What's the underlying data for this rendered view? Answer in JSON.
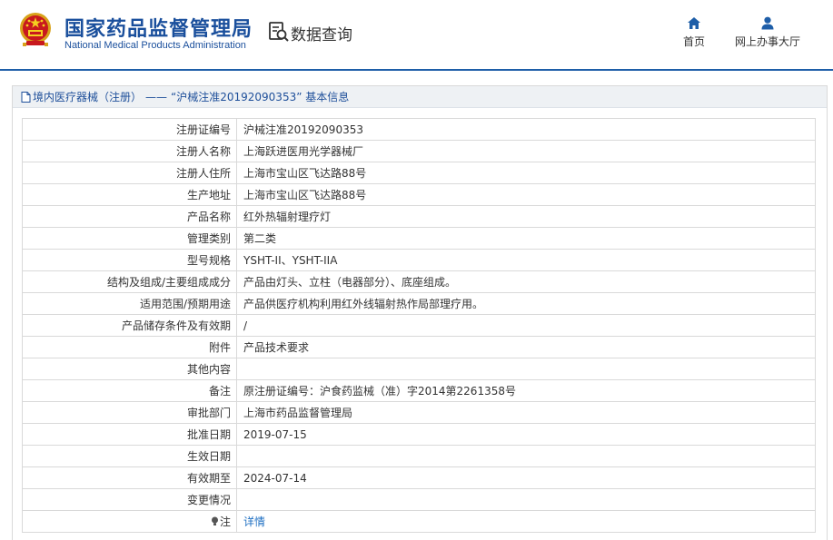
{
  "header": {
    "brand_cn": "国家药品监督管理局",
    "brand_en": "National Medical Products Administration",
    "query_label": "数据查询",
    "nav": [
      {
        "label": "首页",
        "icon": "home-icon"
      },
      {
        "label": "网上办事大厅",
        "icon": "user-icon"
      }
    ],
    "accent": "#1e5ea8"
  },
  "breadcrumb": {
    "root": "境内医疗器械（注册）",
    "separator": "——",
    "current": "“沪械注准20192090353” 基本信息"
  },
  "rows": [
    {
      "label": "注册证编号",
      "value": "沪械注准20192090353"
    },
    {
      "label": "注册人名称",
      "value": "上海跃进医用光学器械厂"
    },
    {
      "label": "注册人住所",
      "value": "上海市宝山区飞达路88号"
    },
    {
      "label": "生产地址",
      "value": "上海市宝山区飞达路88号"
    },
    {
      "label": "产品名称",
      "value": "红外热辐射理疗灯"
    },
    {
      "label": "管理类别",
      "value": "第二类"
    },
    {
      "label": "型号规格",
      "value": "YSHT-II、YSHT-IIA"
    },
    {
      "label": "结构及组成/主要组成成分",
      "value": "产品由灯头、立柱（电器部分）、底座组成。"
    },
    {
      "label": "适用范围/预期用途",
      "value": "产品供医疗机构利用红外线辐射热作局部理疗用。"
    },
    {
      "label": "产品储存条件及有效期",
      "value": "/"
    },
    {
      "label": "附件",
      "value": "产品技术要求"
    },
    {
      "label": "其他内容",
      "value": ""
    },
    {
      "label": "备注",
      "value": "原注册证编号：沪食药监械（准）字2014第2261358号"
    },
    {
      "label": "审批部门",
      "value": "上海市药品监督管理局"
    },
    {
      "label": "批准日期",
      "value": "2019-07-15"
    },
    {
      "label": "生效日期",
      "value": ""
    },
    {
      "label": "有效期至",
      "value": "2024-07-14"
    },
    {
      "label": "变更情况",
      "value": ""
    }
  ],
  "note_row": {
    "label": "注",
    "icon": "lightbulb-icon",
    "link": "详情"
  }
}
